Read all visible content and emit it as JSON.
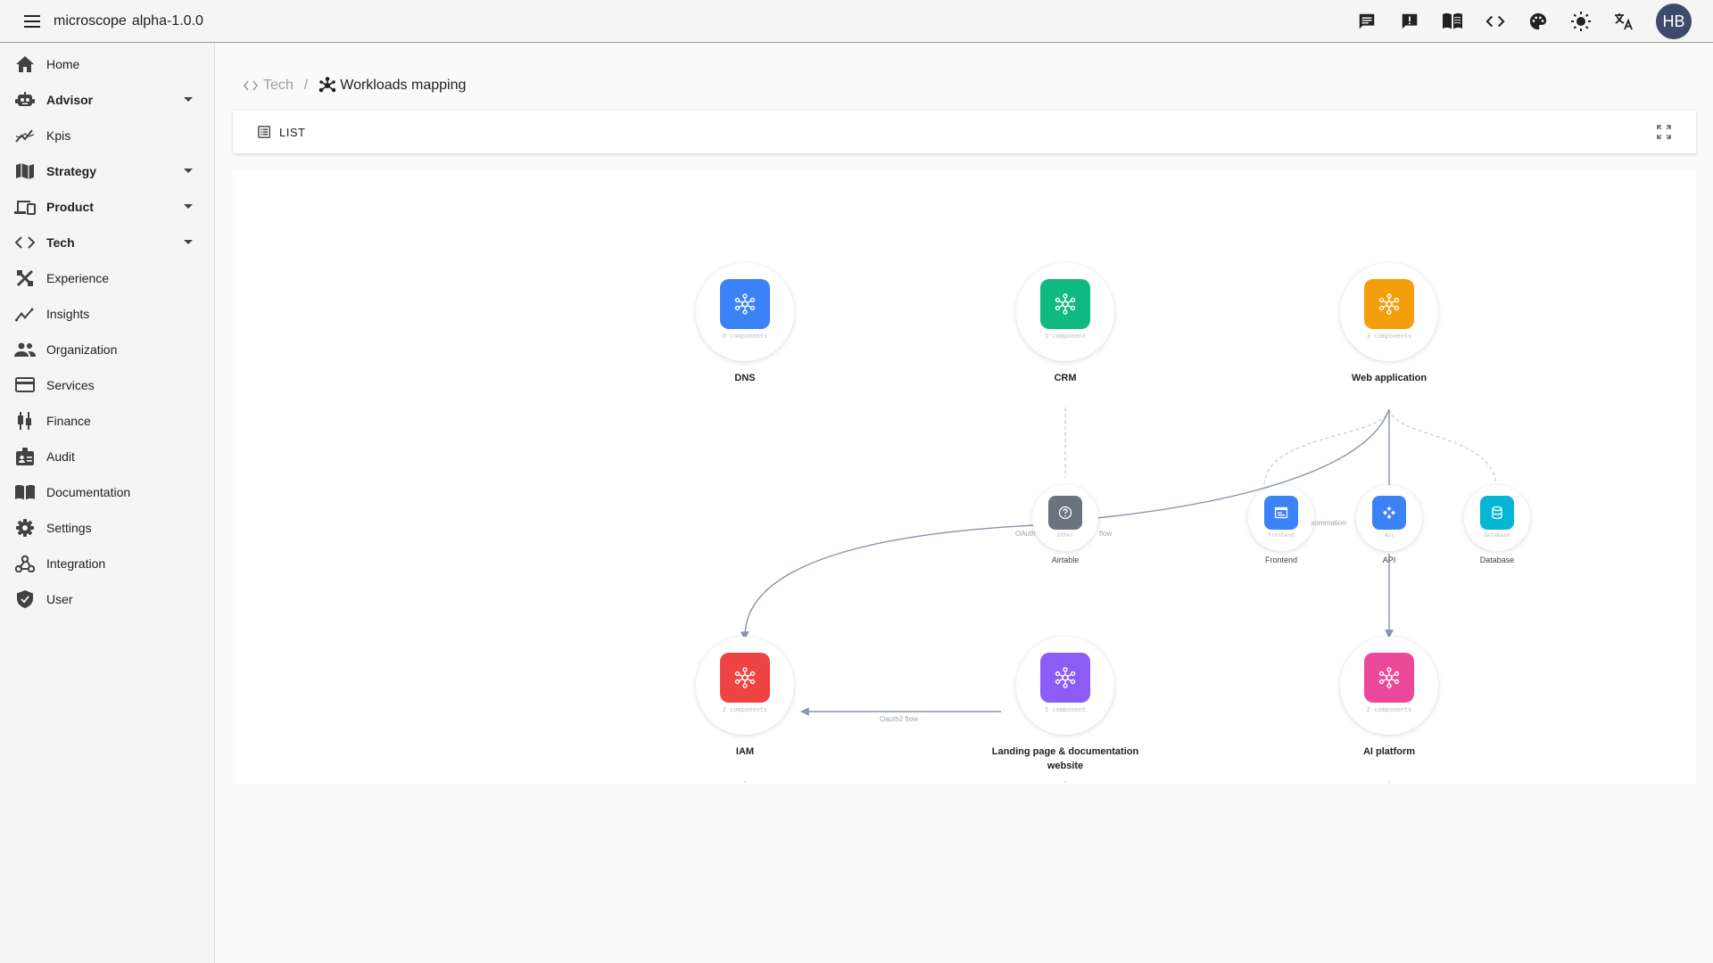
{
  "app": {
    "name": "microscope",
    "version": "alpha-1.0.0",
    "avatar_initials": "HB"
  },
  "topbar_icons": [
    "chat-icon",
    "feedback-icon",
    "documentation-book-icon",
    "code-icon",
    "palette-icon",
    "brightness-icon",
    "translate-icon"
  ],
  "sidebar": {
    "items": [
      {
        "label": "Home",
        "icon": "home-icon",
        "expandable": false
      },
      {
        "label": "Advisor",
        "icon": "robot-icon",
        "expandable": true
      },
      {
        "label": "Kpis",
        "icon": "chart-line-icon",
        "expandable": false
      },
      {
        "label": "Strategy",
        "icon": "map-icon",
        "expandable": true
      },
      {
        "label": "Product",
        "icon": "devices-icon",
        "expandable": true
      },
      {
        "label": "Tech",
        "icon": "code-icon",
        "expandable": true
      },
      {
        "label": "Experience",
        "icon": "design-tools-icon",
        "expandable": false
      },
      {
        "label": "Insights",
        "icon": "insights-icon",
        "expandable": false
      },
      {
        "label": "Organization",
        "icon": "people-icon",
        "expandable": false
      },
      {
        "label": "Services",
        "icon": "card-icon",
        "expandable": false
      },
      {
        "label": "Finance",
        "icon": "candlestick-icon",
        "expandable": false
      },
      {
        "label": "Audit",
        "icon": "badge-icon",
        "expandable": false
      },
      {
        "label": "Documentation",
        "icon": "book-icon",
        "expandable": false
      },
      {
        "label": "Settings",
        "icon": "gear-icon",
        "expandable": false
      },
      {
        "label": "Integration",
        "icon": "webhook-icon",
        "expandable": false
      },
      {
        "label": "User",
        "icon": "shield-icon",
        "expandable": false
      }
    ]
  },
  "breadcrumb": {
    "root": "Tech",
    "separator": "/",
    "current": "Workloads mapping"
  },
  "toolbar": {
    "list_label": "LIST"
  },
  "graph": {
    "workloads": [
      {
        "id": "dns",
        "label": "DNS",
        "sub": "0 components",
        "color": "#3b82f6"
      },
      {
        "id": "crm",
        "label": "CRM",
        "sub": "1 component",
        "color": "#10b981"
      },
      {
        "id": "web",
        "label": "Web application",
        "sub": "3 components",
        "color": "#f59e0b"
      },
      {
        "id": "iam",
        "label": "IAM",
        "sub": "2 components",
        "color": "#ef4444"
      },
      {
        "id": "landing",
        "label": "Landing page & documentation website",
        "sub": "1 component",
        "color": "#8b5cf6"
      },
      {
        "id": "ai",
        "label": "AI platform",
        "sub": "2 components",
        "color": "#ec4899"
      }
    ],
    "components": [
      {
        "id": "airtable",
        "label": "Airtable",
        "sub": "Other",
        "color": "#6b7280",
        "icon": "help-circle-icon"
      },
      {
        "id": "frontend",
        "label": "Frontend",
        "sub": "Frontend",
        "color": "#3b82f6",
        "icon": "browser-window-icon"
      },
      {
        "id": "api",
        "label": "API",
        "sub": "Api",
        "color": "#3b82f6",
        "icon": "api-icon"
      },
      {
        "id": "database",
        "label": "Database",
        "sub": "Database",
        "color": "#06b6d4",
        "icon": "database-icon"
      }
    ],
    "edge_labels": {
      "oauth_left": "OAuth",
      "oauth_right": "flow",
      "consommation": "Consommation",
      "oauth2_flow": "Oauth2 flow"
    }
  }
}
